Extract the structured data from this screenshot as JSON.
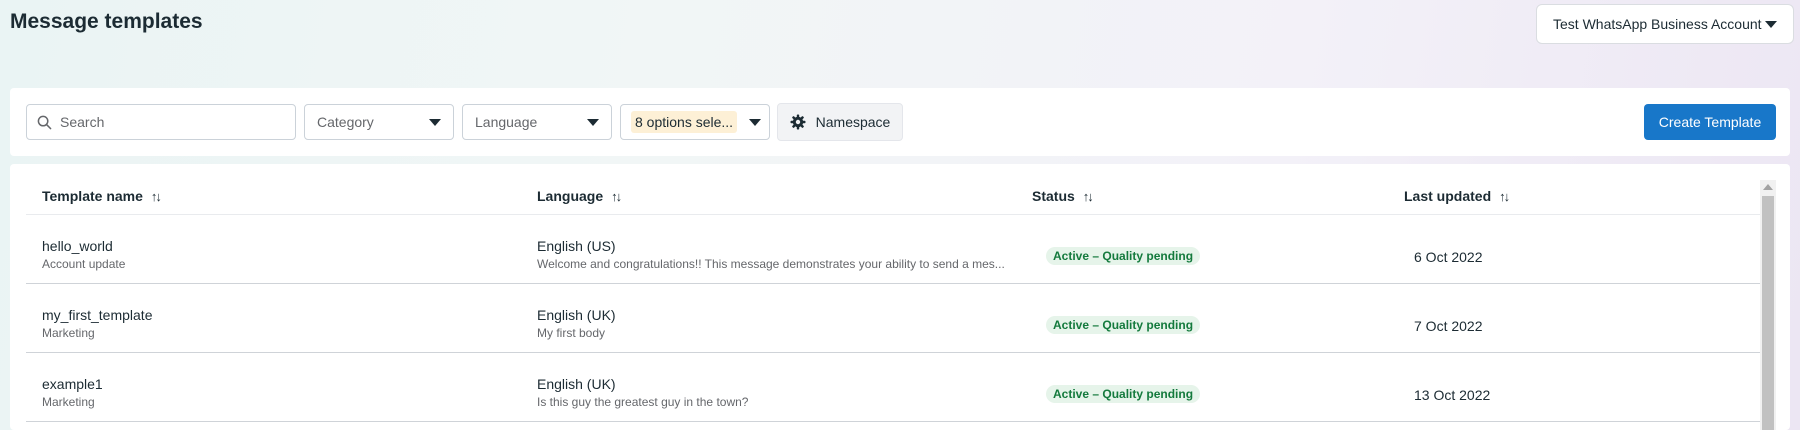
{
  "page": {
    "title": "Message templates"
  },
  "account": {
    "label": "Test WhatsApp Business Account"
  },
  "filters": {
    "search_placeholder": "Search",
    "category_label": "Category",
    "language_label": "Language",
    "status_label": "8 options sele...",
    "namespace_label": "Namespace",
    "create_label": "Create Template"
  },
  "table": {
    "headers": {
      "name": "Template name",
      "language": "Language",
      "status": "Status",
      "updated": "Last updated",
      "sort_icon": "↑↓"
    },
    "rows": [
      {
        "name": "hello_world",
        "category": "Account update",
        "language": "English (US)",
        "body": "Welcome and congratulations!! This message demonstrates your ability to send a mes...",
        "status": "Active – Quality pending",
        "updated": "6 Oct 2022"
      },
      {
        "name": "my_first_template",
        "category": "Marketing",
        "language": "English (UK)",
        "body": "My first body",
        "status": "Active – Quality pending",
        "updated": "7 Oct 2022"
      },
      {
        "name": "example1",
        "category": "Marketing",
        "language": "English (UK)",
        "body": "Is this guy the greatest guy in the town?",
        "status": "Active – Quality pending",
        "updated": "13 Oct 2022"
      }
    ]
  },
  "colors": {
    "primary": "#1877c9",
    "status_bg": "#e6f4ea",
    "status_text": "#147a3d",
    "chip_bg": "#fdf0d6"
  },
  "icons": {
    "search": "search-icon",
    "caret": "caret-down-icon",
    "gear": "gear-icon",
    "sort": "sort-icon"
  }
}
